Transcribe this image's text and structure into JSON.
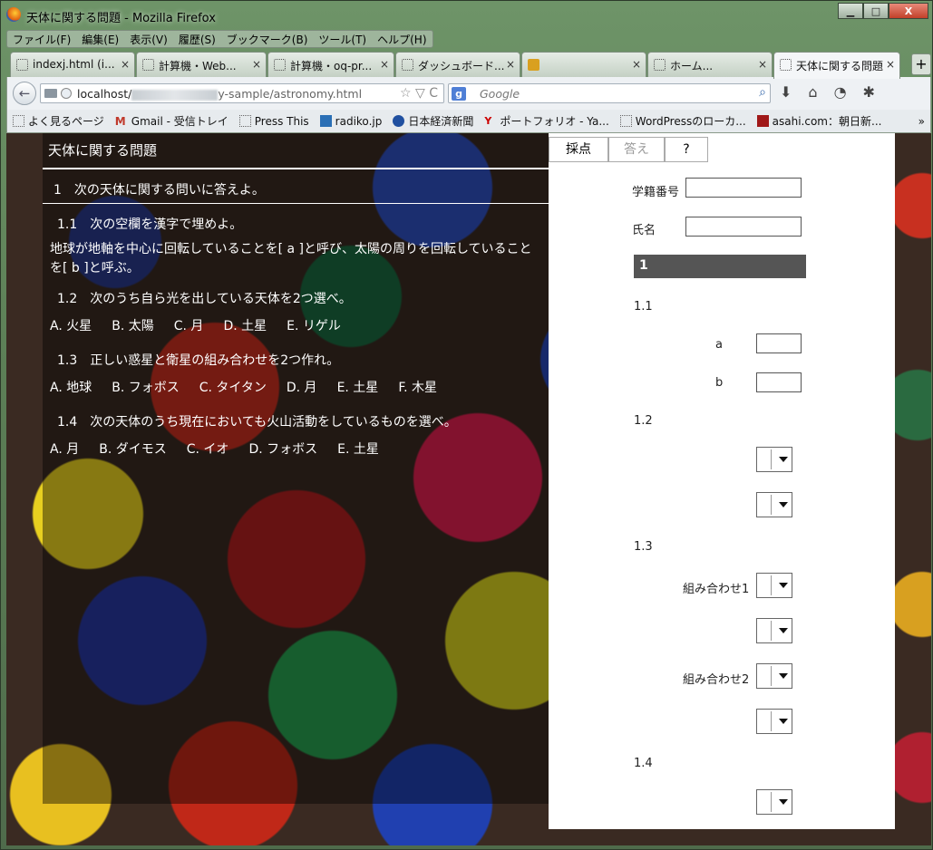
{
  "window": {
    "title": "天体に関する問題 - Mozilla Firefox",
    "minimize": "▁",
    "maximize": "□",
    "close": "X"
  },
  "menu": [
    "ファイル(F)",
    "編集(E)",
    "表示(V)",
    "履歴(S)",
    "ブックマーク(B)",
    "ツール(T)",
    "ヘルプ(H)"
  ],
  "tabs": [
    {
      "label": "indexj.html (i...",
      "active": false
    },
    {
      "label": "計算機・Web...",
      "active": false
    },
    {
      "label": "計算機・oq-pr...",
      "active": false
    },
    {
      "label": "ダッシュボード...",
      "active": false
    },
    {
      "label": "",
      "active": false
    },
    {
      "label": "ホーム...",
      "active": false
    },
    {
      "label": "天体に関する問題",
      "active": true
    }
  ],
  "newtab": "+",
  "tabclose": "×",
  "nav": {
    "back": "←",
    "url_host": "localhost/",
    "url_path": "y-sample/astronomy.html",
    "url_icons": "☆ ▽ C",
    "search_engine": "g",
    "search_placeholder": "Google",
    "search_icon": "⌕",
    "download": "⬇",
    "home": "⌂",
    "sync": "◔",
    "tools": "✱"
  },
  "bookmarks": [
    "よく見るページ",
    "Gmail - 受信トレイ",
    "Press This",
    "radiko.jp",
    "日本経済新聞",
    "ポートフォリオ - Ya...",
    "WordPressのローカ...",
    "asahi.com：朝日新..."
  ],
  "bookmark_more": "»",
  "questions": {
    "title": "天体に関する問題",
    "section": "1　次の天体に関する問いに答えよ。",
    "q11": "1.1　次の空欄を漢字で埋めよ。",
    "q11_text": "地球が地軸を中心に回転していることを[ a ]と呼び、太陽の周りを回転していることを[ b ]と呼ぶ。",
    "q12": "1.2　次のうち自ら光を出している天体を2つ選べ。",
    "q12_choices": [
      "A. 火星",
      "B. 太陽",
      "C. 月",
      "D. 土星",
      "E. リゲル"
    ],
    "q13": "1.3　正しい惑星と衛星の組み合わせを2つ作れ。",
    "q13_choices": [
      "A. 地球",
      "B. フォボス",
      "C. タイタン",
      "D. 月",
      "E. 土星",
      "F. 木星"
    ],
    "q14": "1.4　次の天体のうち現在においても火山活動をしているものを選べ。",
    "q14_choices": [
      "A. 月",
      "B. ダイモス",
      "C. イオ",
      "D. フォボス",
      "E. 土星"
    ]
  },
  "answer_panel": {
    "tabs": [
      "採点",
      "答え",
      "?"
    ],
    "student_id_label": "学籍番号",
    "name_label": "氏名",
    "section": "1",
    "s11": "1.1",
    "a_label": "a",
    "b_label": "b",
    "s12": "1.2",
    "s13": "1.3",
    "combo1": "組み合わせ1",
    "combo2": "組み合わせ2",
    "s14": "1.4"
  }
}
